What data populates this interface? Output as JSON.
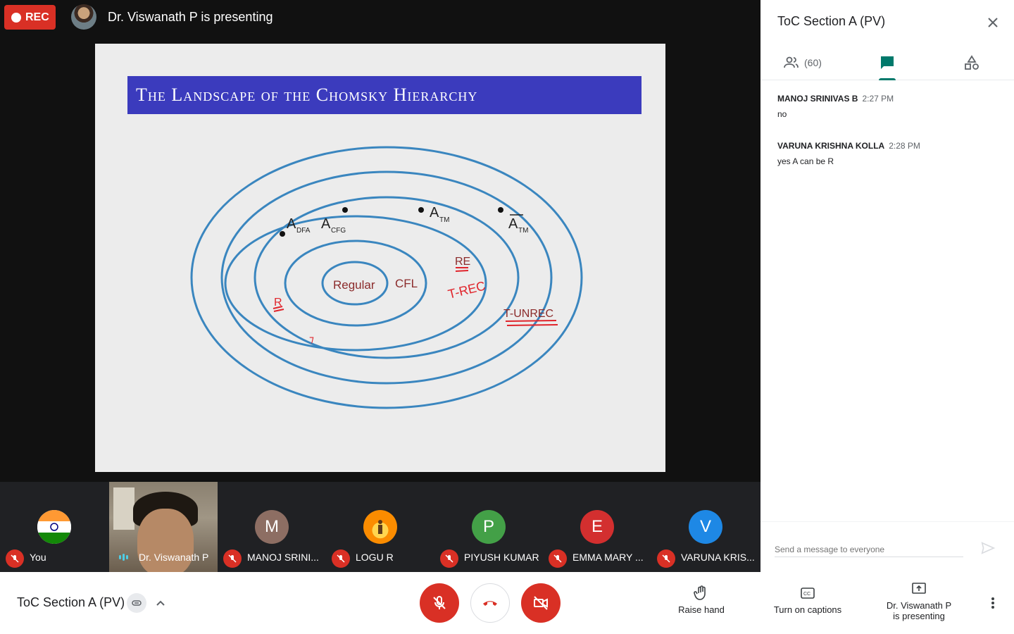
{
  "recording": {
    "label": "REC"
  },
  "presenter_banner": {
    "text": "Dr. Viswanath P is presenting"
  },
  "slide": {
    "title": "The Landscape of the Chomsky Hierarchy",
    "labels": {
      "regular": "Regular",
      "cfl": "CFL",
      "re": "RE",
      "t_rec": "T-REC",
      "t_unrec": "T-UNREC",
      "r": "R",
      "a_dfa": "A",
      "a_dfa_sub": "DFA",
      "a_cfg": "A",
      "a_cfg_sub": "CFG",
      "a_tm": "A",
      "a_tm_sub": "TM",
      "a_tm_bar": "A",
      "a_tm_bar_sub": "TM"
    }
  },
  "participants": [
    {
      "name": "You",
      "avatar_letter": "",
      "color": "#ffffff",
      "icon": "india-flag-icon"
    },
    {
      "name": "Dr. Viswanath P",
      "avatar_letter": "",
      "color": "",
      "icon": "video"
    },
    {
      "name": "MANOJ SRINI...",
      "avatar_letter": "M",
      "color": "#8d6e63"
    },
    {
      "name": "LOGU R",
      "avatar_letter": "",
      "color": "#fb8c00",
      "icon": "sunset-icon"
    },
    {
      "name": "PIYUSH KUMAR",
      "avatar_letter": "P",
      "color": "#43a047"
    },
    {
      "name": "EMMA MARY ...",
      "avatar_letter": "E",
      "color": "#d32f2f"
    },
    {
      "name": "VARUNA KRIS...",
      "avatar_letter": "V",
      "color": "#1e88e5"
    }
  ],
  "panel": {
    "title": "ToC Section A (PV)",
    "people_count": "(60)",
    "messages": [
      {
        "sender": "MANOJ SRINIVAS B",
        "time": "2:27 PM",
        "text": "no"
      },
      {
        "sender": "VARUNA KRISHNA KOLLA",
        "time": "2:28 PM",
        "text": "yes A can be R"
      }
    ],
    "compose_placeholder": "Send a message to everyone"
  },
  "bottom_bar": {
    "meeting_name": "ToC Section A (PV)",
    "raise_hand": "Raise hand",
    "captions": "Turn on captions",
    "presenting_line1": "Dr. Viswanath P",
    "presenting_line2": "is presenting"
  },
  "colors": {
    "red": "#d93025",
    "accent": "#00796b",
    "slide_title_bg": "#3b3bbd",
    "ellipse": "#3a86bf",
    "annotation": "#e0242b"
  }
}
